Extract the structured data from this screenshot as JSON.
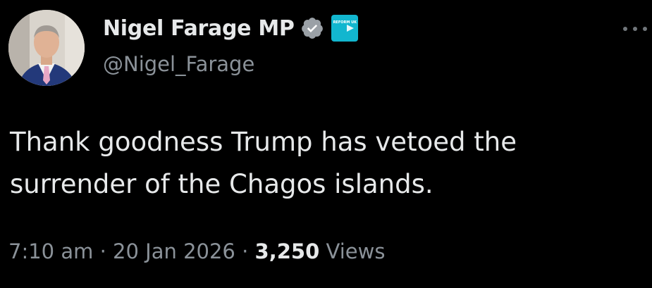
{
  "author": {
    "display_name": "Nigel Farage MP",
    "handle": "@Nigel_Farage",
    "verified_icon": "verified-badge-icon",
    "affiliate_badge_text": "REFORM UK"
  },
  "tweet": {
    "text_line_1": "Thank goodness Trump has vetoed the",
    "text_line_2": "surrender of the Chagos islands."
  },
  "meta": {
    "time": "7:10 am",
    "separator_1": " · ",
    "date": "20 Jan 2026",
    "separator_2": " · ",
    "views_count": "3,250",
    "views_label": "Views"
  },
  "colors": {
    "background": "#000000",
    "primary_text": "#e7e9ea",
    "secondary_text": "#8b9299",
    "verified_badge": "#9aa0a6",
    "affiliate_badge": "#12b6cf"
  }
}
